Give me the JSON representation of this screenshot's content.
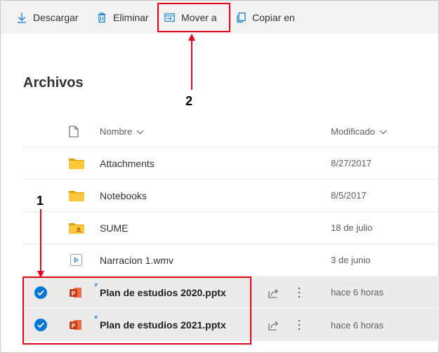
{
  "toolbar": {
    "download_label": "Descargar",
    "delete_label": "Eliminar",
    "move_label": "Mover a",
    "copy_label": "Copiar en"
  },
  "page_title": "Archivos",
  "callouts": {
    "one": "1",
    "two": "2"
  },
  "columns": {
    "name": "Nombre",
    "modified": "Modificado"
  },
  "files": [
    {
      "name": "Attachments",
      "modified": "8/27/2017",
      "icon": "folder-icon",
      "selected": false
    },
    {
      "name": "Notebooks",
      "modified": "8/5/2017",
      "icon": "folder-icon",
      "selected": false
    },
    {
      "name": "SUME",
      "modified": "18 de julio",
      "icon": "shared-folder-icon",
      "selected": false
    },
    {
      "name": "Narracion 1.wmv",
      "modified": "3 de junio",
      "icon": "video-file-icon",
      "selected": false
    },
    {
      "name": "Plan de estudios 2020.pptx",
      "modified": "hace 6 horas",
      "icon": "powerpoint-file-icon",
      "selected": true
    },
    {
      "name": "Plan de estudios 2021.pptx",
      "modified": "hace 6 horas",
      "icon": "powerpoint-file-icon",
      "selected": true
    }
  ],
  "colors": {
    "accent": "#0078d4",
    "highlight": "#e3001b",
    "selected_row": "#edebe9",
    "folder": "#ffb900",
    "powerpoint": "#c43e1c"
  }
}
